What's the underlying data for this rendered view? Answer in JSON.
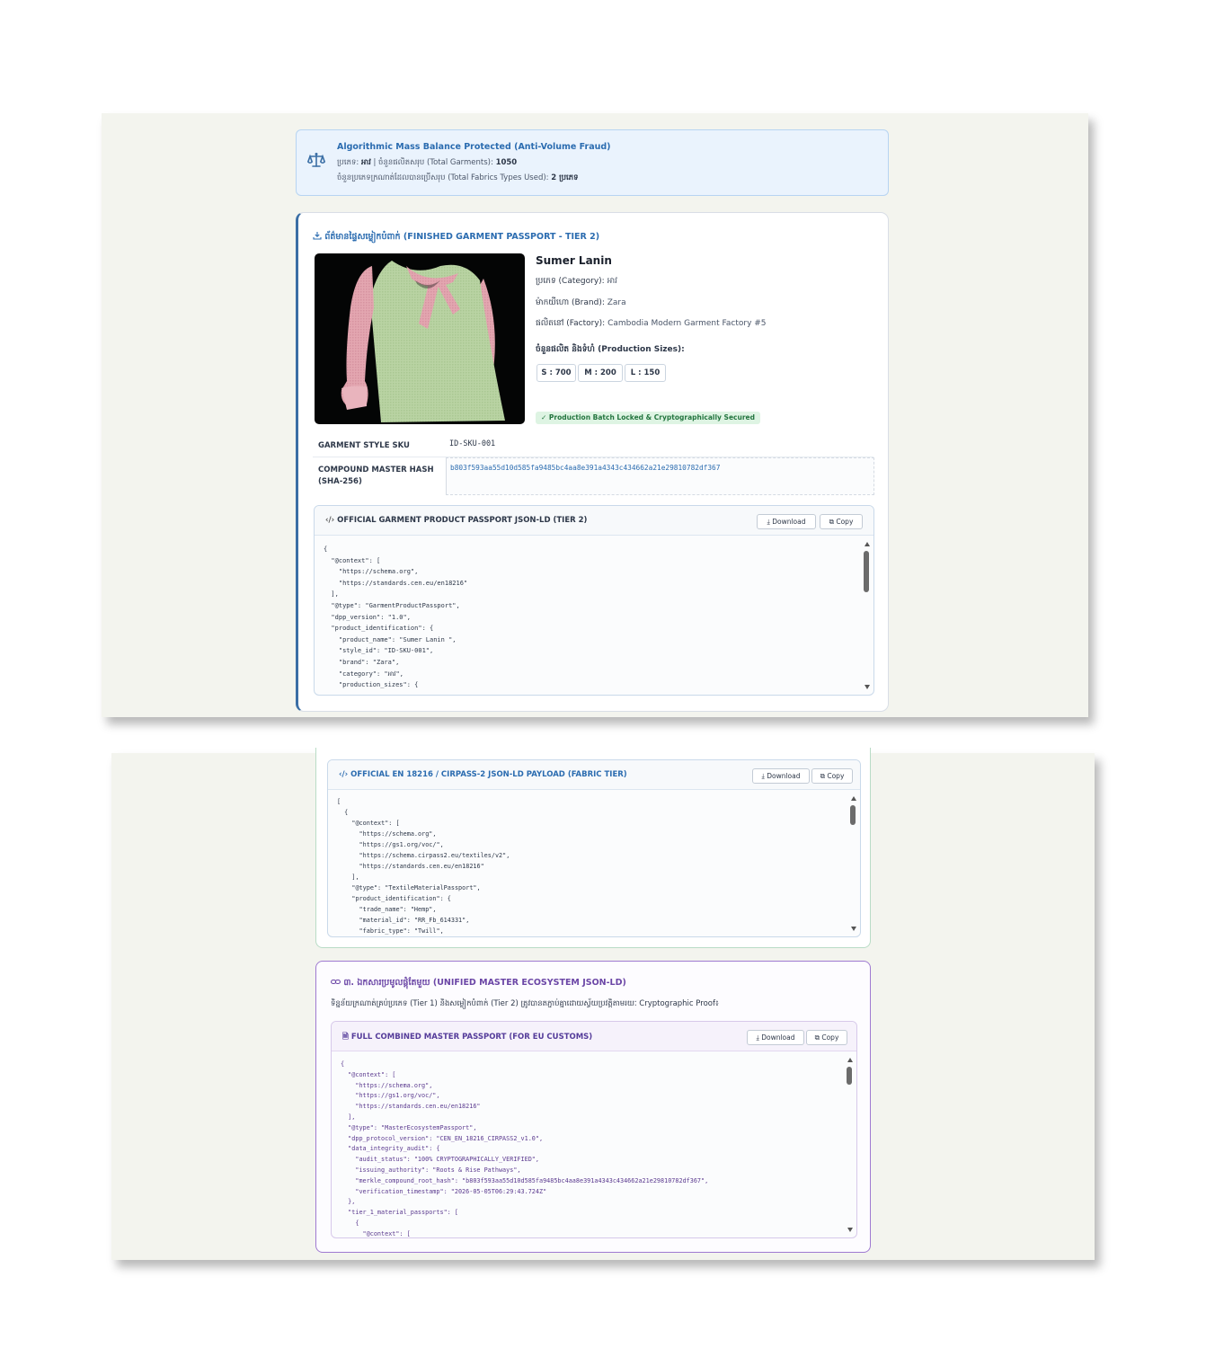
{
  "mass_balance": {
    "title": "Algorithmic Mass Balance Protected (Anti-Volume Fraud)",
    "line1_prefix": "ប្រភេទ:",
    "line1_category": "អាវ",
    "line1_text": "| ចំនួនផលិតសរុប (Total Garments):",
    "line1_value": "1050",
    "line2_text": "ចំនួនប្រភេទក្រណាត់ដែលបានប្រើសរុប (Total Fabrics Types Used):",
    "line2_value": "2 ប្រភេទ"
  },
  "garment": {
    "section_title": "ព័ត៌មានផ្ទៃសម្លៀកបំពាក់ (FINISHED GARMENT PASSPORT - TIER 2)",
    "name": "Sumer Lanin",
    "category_label": "ប្រភេទ (Category):",
    "category_value": "អាវ",
    "brand_label": "ម៉ាកយីហោ (Brand):",
    "brand_value": "Zara",
    "factory_label": "ផលិតនៅ (Factory):",
    "factory_value": "Cambodia Modern Garment Factory #5",
    "sizes_label": "ចំនួនផលិត និងទំហំ (Production Sizes):",
    "sizes": [
      "S : 700",
      "M : 200",
      "L : 150"
    ],
    "locked_badge": "✓ Production Batch Locked & Cryptographically Secured",
    "sku_label": "GARMENT STYLE SKU",
    "sku_value": "ID-SKU-001",
    "hash_label_1": "COMPOUND MASTER HASH",
    "hash_label_2": "(SHA-256)",
    "hash_value": "b803f593aa55d10d585fa9485bc4aa8e391a4343c434662a21e29810782df367"
  },
  "garment_json": {
    "title": "OFFICIAL GARMENT PRODUCT PASSPORT JSON-LD (TIER 2)",
    "download": "Download",
    "copy": "Copy",
    "code": "{\n  \"@context\": [\n    \"https://schema.org\",\n    \"https://standards.cen.eu/en18216\"\n  ],\n  \"@type\": \"GarmentProductPassport\",\n  \"dpp_version\": \"1.0\",\n  \"product_identification\": {\n    \"product_name\": \"Sumer Lanin \",\n    \"style_id\": \"ID-SKU-001\",\n    \"brand\": \"Zara\",\n    \"category\": \"អាវ\",\n    \"production_sizes\": {"
  },
  "fabric_json": {
    "title": "OFFICIAL EN 18216 / CIRPASS-2 JSON-LD PAYLOAD (FABRIC TIER)",
    "download": "Download",
    "copy": "Copy",
    "code": "[\n  {\n    \"@context\": [\n      \"https://schema.org\",\n      \"https://gs1.org/voc/\",\n      \"https://schema.cirpass2.eu/textiles/v2\",\n      \"https://standards.cen.eu/en18216\"\n    ],\n    \"@type\": \"TextileMaterialPassport\",\n    \"product_identification\": {\n      \"trade_name\": \"Hemp\",\n      \"material_id\": \"RR_Fb_614331\",\n      \"fabric_type\": \"Twill\","
  },
  "master": {
    "section_title": "៣. ឯកសារប្រមូលផ្តុំតែមួយ (UNIFIED MASTER ECOSYSTEM JSON-LD)",
    "description": "ទិន្នន័យក្រណាត់គ្រប់ប្រភេទ (Tier 1) និងសម្លៀកបំពាក់ (Tier 2) ត្រូវបានតភ្ជាប់គ្នាដោយស្វ័យប្រវត្តិតាមរយៈ Cryptographic Proof៖",
    "json_title": "FULL COMBINED MASTER PASSPORT (FOR EU CUSTOMS)",
    "download": "Download",
    "copy": "Copy",
    "code": "{\n  \"@context\": [\n    \"https://schema.org\",\n    \"https://gs1.org/voc/\",\n    \"https://standards.cen.eu/en18216\"\n  ],\n  \"@type\": \"MasterEcosystemPassport\",\n  \"dpp_protocol_version\": \"CEN_EN_18216_CIRPASS2_v1.0\",\n  \"data_integrity_audit\": {\n    \"audit_status\": \"100% CRYPTOGRAPHICALLY_VERIFIED\",\n    \"issuing_authority\": \"Roots & Rise Pathways\",\n    \"merkle_compound_root_hash\": \"b803f593aa55d10d585fa9485bc4aa8e391a4343c434662a21e29810782df367\",\n    \"verification_timestamp\": \"2026-05-05T06:29:43.724Z\"\n  },\n  \"tier_1_material_passports\": [\n    {\n      \"@context\": ["
  },
  "colors": {
    "accent_blue": "#2b6cb0",
    "accent_green": "#23753f",
    "accent_purple": "#6b46a6"
  }
}
